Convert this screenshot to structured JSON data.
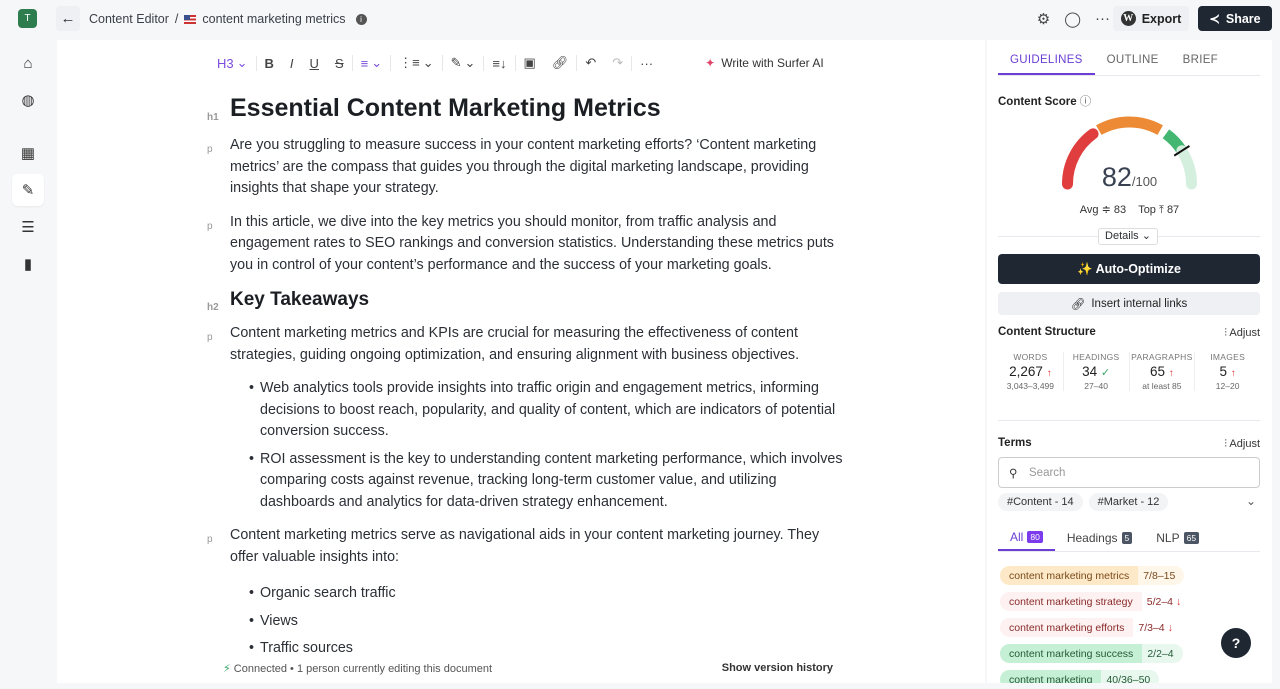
{
  "header": {
    "avatar": "T",
    "breadcrumb_root": "Content Editor",
    "separator": "/",
    "doc_title": "content marketing metrics",
    "export_label": "Export",
    "share_label": "Share"
  },
  "toolbar": {
    "heading": "H3",
    "ai_label": "Write with Surfer AI"
  },
  "doc": {
    "h1": "Essential Content Marketing Metrics",
    "p1": "Are you struggling to measure success in your content marketing efforts? ‘Content marketing metrics’ are the compass that guides you through the digital marketing landscape, providing insights that shape your strategy.",
    "p2": "In this article, we dive into the key metrics you should monitor, from traffic analysis and engagement rates to SEO rankings and conversion statistics. Understanding these metrics puts you in control of your content’s performance and the success of your marketing goals.",
    "h2": "Key Takeaways",
    "p3": "Content marketing metrics and KPIs are crucial for measuring the effectiveness of content strategies, guiding ongoing optimization, and ensuring alignment with business objectives.",
    "bullets1": [
      "Web analytics tools provide insights into traffic origin and engagement metrics, informing decisions to boost reach, popularity, and quality of content, which are indicators of potential conversion success.",
      "ROI assessment is the key to understanding content marketing performance, which involves comparing costs against revenue, tracking long-term customer value, and utilizing dashboards and analytics for data-driven strategy enhancement."
    ],
    "p4": "Content marketing metrics serve as navigational aids in your content marketing journey. They offer valuable insights into:",
    "bullets2": [
      "Organic search traffic",
      "Views",
      "Traffic sources"
    ]
  },
  "footer": {
    "status": "Connected • 1 person currently editing this document",
    "history": "Show version history"
  },
  "panel": {
    "tabs": [
      "GUIDELINES",
      "OUTLINE",
      "BRIEF"
    ],
    "score_label": "Content Score",
    "score": "82",
    "score_max": "/100",
    "avg_label": "Avg",
    "avg": "83",
    "top_label": "Top",
    "top": "87",
    "details": "Details",
    "auto_optimize": "✨ Auto-Optimize",
    "internal_links": "Insert internal links",
    "structure_label": "Content Structure",
    "adjust": "Adjust",
    "stats": [
      {
        "h": "WORDS",
        "v": "2,267",
        "s": "up",
        "r": "3,043–3,499"
      },
      {
        "h": "HEADINGS",
        "v": "34",
        "s": "ok",
        "r": "27–40"
      },
      {
        "h": "PARAGRAPHS",
        "v": "65",
        "s": "up",
        "r": "at least 85"
      },
      {
        "h": "IMAGES",
        "v": "5",
        "s": "up",
        "r": "12–20"
      }
    ],
    "terms_label": "Terms",
    "search_placeholder": "Search",
    "chips": [
      "#Content - 14",
      "#Market - 12"
    ],
    "term_tabs": [
      {
        "l": "All",
        "n": "80"
      },
      {
        "l": "Headings",
        "n": "5"
      },
      {
        "l": "NLP",
        "n": "65"
      }
    ],
    "terms": [
      {
        "t": "content marketing metrics",
        "c": "7/8–15",
        "st": "ok-orange"
      },
      {
        "t": "content marketing strategy",
        "c": "5/2–4",
        "st": "over"
      },
      {
        "t": "content marketing efforts",
        "c": "7/3–4",
        "st": "over"
      },
      {
        "t": "content marketing success",
        "c": "2/2–4",
        "st": "good"
      },
      {
        "t": "content marketing",
        "c": "40/36–50",
        "st": "good"
      }
    ]
  },
  "colors": {
    "accent": "#6b3fd6",
    "dark": "#1f2733",
    "red": "#e03e3e",
    "orange": "#ec8a35",
    "green": "#43b771"
  }
}
